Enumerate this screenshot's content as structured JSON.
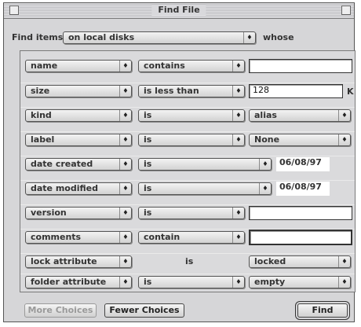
{
  "window": {
    "title": "Find File"
  },
  "header": {
    "find_items_label": "Find items",
    "location_value": "on local disks",
    "whose_label": "whose"
  },
  "icons": {
    "popup_arrow": "up-down-arrows-icon",
    "close": "close-box-icon",
    "collapse": "collapse-box-icon"
  },
  "criteria": [
    {
      "attribute": "name",
      "operator": "contains",
      "value": ""
    },
    {
      "attribute": "size",
      "operator": "is less than",
      "value": "128",
      "unit": "K"
    },
    {
      "attribute": "kind",
      "operator": "is",
      "value": "alias"
    },
    {
      "attribute": "label",
      "operator": "is",
      "value": "None"
    },
    {
      "attribute": "date created",
      "operator": "is",
      "value": "06/08/97"
    },
    {
      "attribute": "date modified",
      "operator": "is",
      "value": "06/08/97"
    },
    {
      "attribute": "version",
      "operator": "is",
      "value": ""
    },
    {
      "attribute": "comments",
      "operator": "contain",
      "value": ""
    },
    {
      "attribute": "lock attribute",
      "operator": "is",
      "value": "locked"
    },
    {
      "attribute": "folder attribute",
      "operator": "is",
      "value": "empty"
    }
  ],
  "buttons": {
    "more_choices": "More Choices",
    "fewer_choices": "Fewer Choices",
    "find": "Find"
  }
}
